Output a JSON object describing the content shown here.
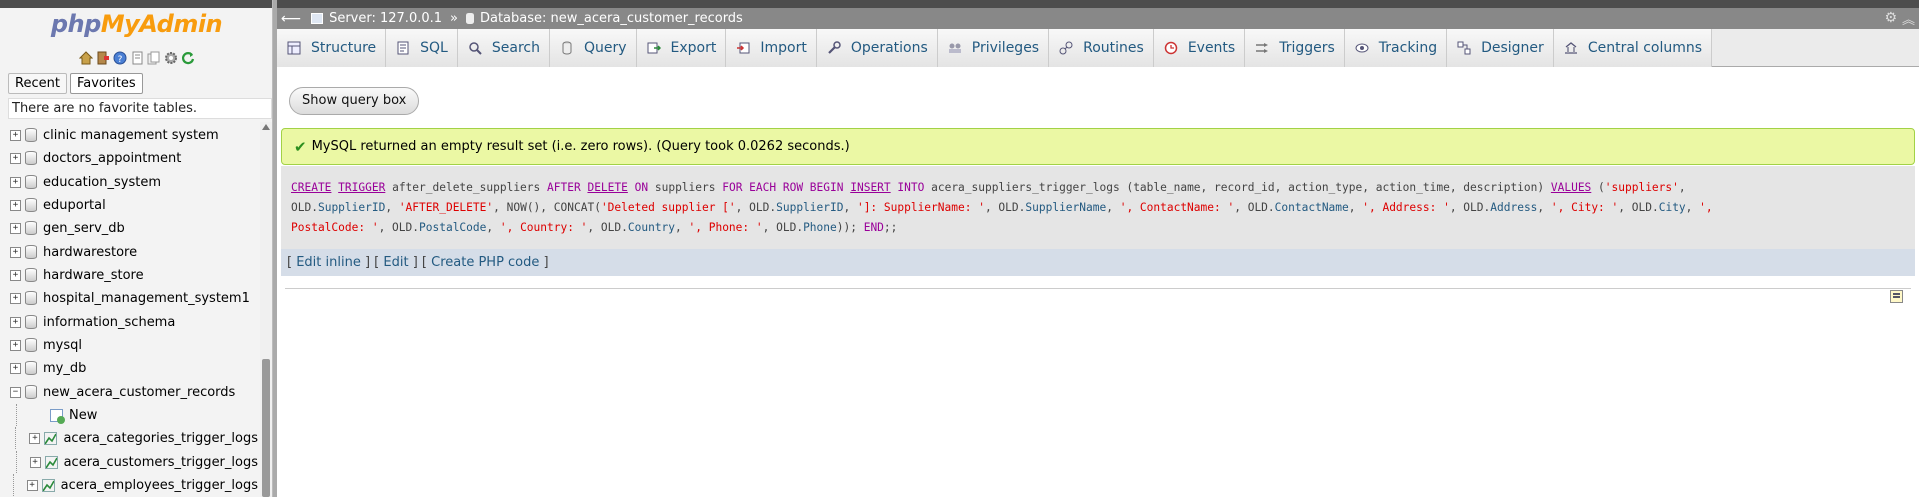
{
  "navigation": {
    "logo_php": "php",
    "logo_myadmin": "MyAdmin",
    "quick_icons": [
      "home-icon",
      "logout-icon",
      "help-icon",
      "docs-icon",
      "copy-icon",
      "settings-icon",
      "reload-icon"
    ],
    "tabs": [
      "Recent",
      "Favorites"
    ],
    "favorites_message": "There are no favorite tables.",
    "databases": [
      "clinic management system",
      "doctors_appointment",
      "education_system",
      "eduportal",
      "gen_serv_db",
      "hardwarestore",
      "hardware_store",
      "hospital_management_system1",
      "information_schema",
      "mysql",
      "my_db",
      "new_acera_customer_records"
    ],
    "expanded_db_children": {
      "new_label": "New",
      "tables": [
        "acera_categories_trigger_logs",
        "acera_customers_trigger_logs",
        "acera_employees_trigger_logs"
      ]
    }
  },
  "breadcrumb": {
    "server_label": "Server: 127.0.0.1",
    "separator": "»",
    "database_label": "Database: new_acera_customer_records"
  },
  "tabs": [
    {
      "label": "Structure",
      "icon": "structure-icon"
    },
    {
      "label": "SQL",
      "icon": "sql-icon"
    },
    {
      "label": "Search",
      "icon": "search-icon"
    },
    {
      "label": "Query",
      "icon": "query-icon"
    },
    {
      "label": "Export",
      "icon": "export-icon"
    },
    {
      "label": "Import",
      "icon": "import-icon"
    },
    {
      "label": "Operations",
      "icon": "operations-icon"
    },
    {
      "label": "Privileges",
      "icon": "privileges-icon"
    },
    {
      "label": "Routines",
      "icon": "routines-icon"
    },
    {
      "label": "Events",
      "icon": "events-icon"
    },
    {
      "label": "Triggers",
      "icon": "triggers-icon"
    },
    {
      "label": "Tracking",
      "icon": "tracking-icon"
    },
    {
      "label": "Designer",
      "icon": "designer-icon"
    },
    {
      "label": "Central columns",
      "icon": "central-columns-icon"
    }
  ],
  "show_query_box": "Show query box",
  "success_message": "MySQL returned an empty result set (i.e. zero rows). (Query took 0.0262 seconds.)",
  "edit_links": {
    "edit_inline": "Edit inline",
    "edit": "Edit",
    "create_php": "Create PHP code"
  },
  "colors": {
    "success_bg": "#ebf8a4",
    "success_border": "#a2d246",
    "tab_text": "#235a81",
    "keyword": "#990099",
    "string": "#dd0000"
  }
}
